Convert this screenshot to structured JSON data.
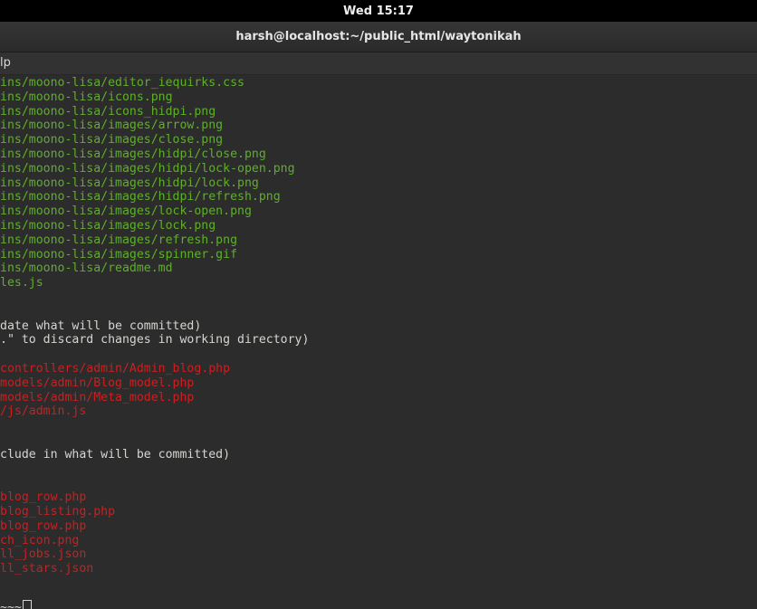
{
  "top_bar": {
    "clock": "Wed 15:17"
  },
  "window": {
    "title": "harsh@localhost:~/public_html/waytonikah"
  },
  "menu": {
    "visible_item": "lp"
  },
  "terminal": {
    "lines": [
      {
        "text": "ins/moono-lisa/editor_iequirks.css",
        "color": "green"
      },
      {
        "text": "ins/moono-lisa/icons.png",
        "color": "green"
      },
      {
        "text": "ins/moono-lisa/icons_hidpi.png",
        "color": "green"
      },
      {
        "text": "ins/moono-lisa/images/arrow.png",
        "color": "green"
      },
      {
        "text": "ins/moono-lisa/images/close.png",
        "color": "green"
      },
      {
        "text": "ins/moono-lisa/images/hidpi/close.png",
        "color": "green"
      },
      {
        "text": "ins/moono-lisa/images/hidpi/lock-open.png",
        "color": "green"
      },
      {
        "text": "ins/moono-lisa/images/hidpi/lock.png",
        "color": "green"
      },
      {
        "text": "ins/moono-lisa/images/hidpi/refresh.png",
        "color": "green"
      },
      {
        "text": "ins/moono-lisa/images/lock-open.png",
        "color": "green"
      },
      {
        "text": "ins/moono-lisa/images/lock.png",
        "color": "green"
      },
      {
        "text": "ins/moono-lisa/images/refresh.png",
        "color": "green"
      },
      {
        "text": "ins/moono-lisa/images/spinner.gif",
        "color": "green"
      },
      {
        "text": "ins/moono-lisa/readme.md",
        "color": "green"
      },
      {
        "text": "les.js",
        "color": "green"
      },
      {
        "text": "",
        "color": "white"
      },
      {
        "text": "",
        "color": "white"
      },
      {
        "text": "date what will be committed)",
        "color": "white"
      },
      {
        "text": ".\" to discard changes in working directory)",
        "color": "white"
      },
      {
        "text": "",
        "color": "white"
      },
      {
        "text": "controllers/admin/Admin_blog.php",
        "color": "red"
      },
      {
        "text": "models/admin/Blog_model.php",
        "color": "red"
      },
      {
        "text": "models/admin/Meta_model.php",
        "color": "red"
      },
      {
        "text": "/js/admin.js",
        "color": "red"
      },
      {
        "text": "",
        "color": "white"
      },
      {
        "text": "",
        "color": "white"
      },
      {
        "text": "clude in what will be committed)",
        "color": "white"
      },
      {
        "text": "",
        "color": "white"
      },
      {
        "text": "",
        "color": "white"
      },
      {
        "text": "blog_row.php",
        "color": "red"
      },
      {
        "text": "blog_listing.php",
        "color": "red"
      },
      {
        "text": "blog_row.php",
        "color": "red"
      },
      {
        "text": "ch_icon.png",
        "color": "red"
      },
      {
        "text": "ll_jobs.json",
        "color": "red"
      },
      {
        "text": "ll_stars.json",
        "color": "red"
      },
      {
        "text": "",
        "color": "white"
      }
    ],
    "prompt_tail": "~~~",
    "colors": {
      "green": "#5faf2a",
      "red": "#cc1f1f",
      "white": "#d3d7cf",
      "background": "#2c2c2c"
    }
  }
}
